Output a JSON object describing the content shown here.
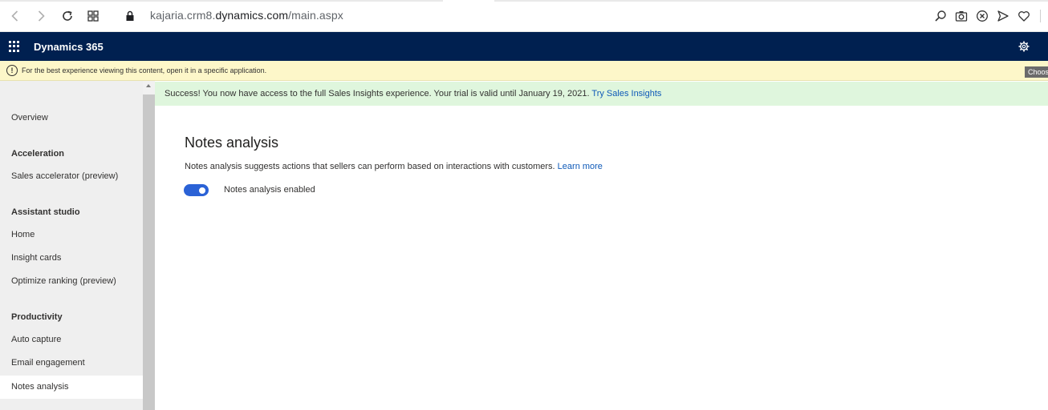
{
  "browser": {
    "url_host_prefix": "kajaria.crm8.",
    "url_host": "dynamics.com",
    "url_path": "/main.aspx",
    "icons": [
      "back-icon",
      "forward-icon",
      "reload-icon",
      "tabs-grid-icon",
      "lock-icon",
      "search-icon",
      "camera-icon",
      "shield-x-icon",
      "send-icon",
      "heart-icon"
    ]
  },
  "header": {
    "app_title": "Dynamics 365",
    "icons": [
      "waffle-icon",
      "settings-icon"
    ],
    "background": "#002050"
  },
  "info_bar": {
    "icon": "!",
    "text": "For the best experience viewing this content, open it in a specific application.",
    "button_label": "Choos"
  },
  "sidebar": {
    "items": [
      {
        "label": "Overview",
        "kind": "item"
      },
      {
        "label": "Acceleration",
        "kind": "heading"
      },
      {
        "label": "Sales accelerator (preview)",
        "kind": "item"
      },
      {
        "label": "Assistant studio",
        "kind": "heading"
      },
      {
        "label": "Home",
        "kind": "item"
      },
      {
        "label": "Insight cards",
        "kind": "item"
      },
      {
        "label": "Optimize ranking (preview)",
        "kind": "item"
      },
      {
        "label": "Productivity",
        "kind": "heading"
      },
      {
        "label": "Auto capture",
        "kind": "item"
      },
      {
        "label": "Email engagement",
        "kind": "item"
      },
      {
        "label": "Notes analysis",
        "kind": "item",
        "selected": true
      }
    ]
  },
  "success_bar": {
    "text": "Success! You now have access to the full Sales Insights experience. Your trial is valid until January 19, 2021.",
    "link": "Try Sales Insights",
    "background": "#dff6dd"
  },
  "main": {
    "title": "Notes analysis",
    "description": "Notes analysis suggests actions that sellers can perform based on interactions with customers.",
    "learn_more": "Learn more",
    "toggle_label": "Notes analysis enabled",
    "toggle_on": true,
    "accent": "#2b62d6"
  }
}
